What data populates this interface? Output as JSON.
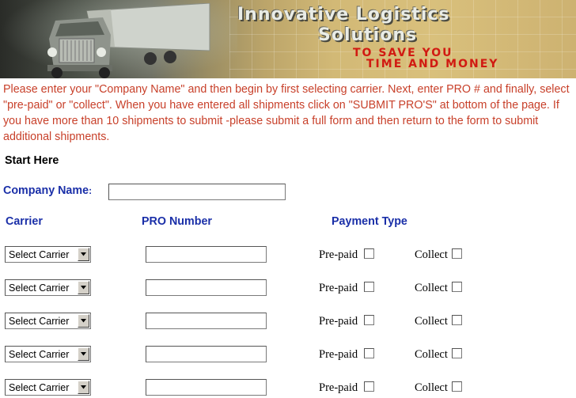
{
  "banner": {
    "title_line1": "Innovative Logistics",
    "title_line2": "Solutions",
    "tagline_line1": "TO  SAVE YOU",
    "tagline_line2": "TIME AND MONEY"
  },
  "instructions": "Please enter your \"Company Name\" and then begin by first selecting carrier.  Next, enter PRO # and finally, select \"pre-paid\" or \"collect\".  When you have entered all shipments click on \"SUBMIT PRO'S\"   at bottom of the page.  If you have more than 10 shipments to submit -please submit a full form and then return to the form to submit additional shipments.",
  "start_here": "Start Here",
  "company": {
    "label": "Company Name",
    "colon": ":",
    "value": ""
  },
  "columns": {
    "carrier": "Carrier",
    "pro": "PRO Number",
    "payment": "Payment Type"
  },
  "rows": [
    {
      "carrier": "Select Carrier",
      "pro": "",
      "prepaid_label": "Pre-paid",
      "collect_label": "Collect"
    },
    {
      "carrier": "Select Carrier",
      "pro": "",
      "prepaid_label": "Pre-paid",
      "collect_label": "Collect"
    },
    {
      "carrier": "Select Carrier",
      "pro": "",
      "prepaid_label": "Pre-paid",
      "collect_label": "Collect"
    },
    {
      "carrier": "Select Carrier",
      "pro": "",
      "prepaid_label": "Pre-paid",
      "collect_label": "Collect"
    },
    {
      "carrier": "Select Carrier",
      "pro": "",
      "prepaid_label": "Pre-paid",
      "collect_label": "Collect"
    }
  ],
  "colors": {
    "instructions_text": "#c8402a",
    "heading_blue": "#1a2fa8",
    "tagline_red": "#d11a12"
  }
}
